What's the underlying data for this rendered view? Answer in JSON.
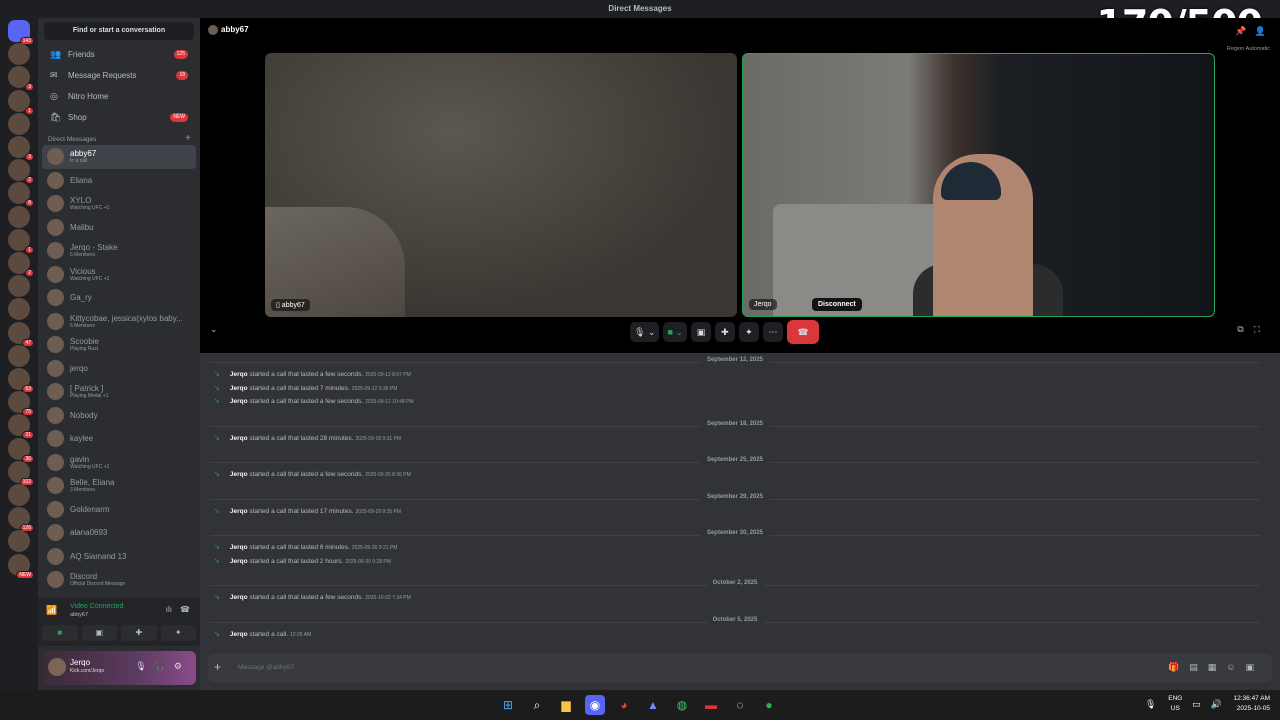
{
  "window": {
    "title": "Direct Messages",
    "counter": "170/500"
  },
  "sidebar": {
    "find": "Find or start a conversation",
    "nav": [
      {
        "label": "Friends",
        "badge": "125",
        "icon": "friends-icon",
        "glyph": "👥"
      },
      {
        "label": "Message Requests",
        "badge": "18",
        "icon": "mail-icon",
        "glyph": "✉"
      },
      {
        "label": "Nitro Home",
        "badge": "",
        "icon": "nitro-icon",
        "glyph": "◎"
      },
      {
        "label": "Shop",
        "badge": "NEW",
        "icon": "shop-icon",
        "glyph": "🛍"
      }
    ],
    "dm_header": "Direct Messages",
    "dms": [
      {
        "name": "abby67",
        "sub": "In a call",
        "active": true
      },
      {
        "name": "Eliana",
        "sub": ""
      },
      {
        "name": "XYLO",
        "sub": "Watching UFC +1"
      },
      {
        "name": "Malibu",
        "sub": ""
      },
      {
        "name": "Jerqo - Stake",
        "sub": "6 Members"
      },
      {
        "name": "Vicious",
        "sub": "Watching UFC +1"
      },
      {
        "name": "Ga_ry",
        "sub": ""
      },
      {
        "name": "Kittycobae, jessica(xylos baby...",
        "sub": "6 Members"
      },
      {
        "name": "Scoobie",
        "sub": "Playing Rust"
      },
      {
        "name": "jerqo",
        "sub": ""
      },
      {
        "name": "[ Patrick ]",
        "sub": "Playing Medal +1"
      },
      {
        "name": "Nobody",
        "sub": ""
      },
      {
        "name": "kaylee",
        "sub": ""
      },
      {
        "name": "gavin",
        "sub": "Watching UFC +1"
      },
      {
        "name": "Belle, Eliana",
        "sub": "3 Members"
      },
      {
        "name": "Goldenarm",
        "sub": ""
      },
      {
        "name": "alana0693",
        "sub": ""
      },
      {
        "name": "AQ Siamand 13",
        "sub": ""
      },
      {
        "name": "Discord",
        "sub": "Official Discord Message"
      }
    ],
    "voice": {
      "status": "Video Connected",
      "channel": "abby67"
    },
    "user": {
      "name": "Jerqo",
      "status": "Kick.com/Jerqo"
    }
  },
  "rail_badges": [
    "143",
    "",
    "3",
    "1",
    "",
    "3",
    "2",
    "8",
    "",
    "1",
    "2",
    "",
    "",
    "47",
    "",
    "63",
    "75",
    "21",
    "36",
    "102",
    "",
    "126",
    "",
    "NEW"
  ],
  "call": {
    "header": "abby67",
    "sub": "Region   Automatic",
    "tile1": "abby67",
    "tile2": "Jerqo",
    "tooltip": "Disconnect"
  },
  "messages": [
    {
      "type": "sep",
      "text": "September 12, 2025"
    },
    {
      "type": "msg",
      "who": "Jerqo",
      "text": "started a call that lasted a few seconds.",
      "ts": "2025-09-12 8:07 PM"
    },
    {
      "type": "msg",
      "who": "Jerqo",
      "text": "started a call that lasted 7 minutes.",
      "ts": "2025-09-12 9:36 PM"
    },
    {
      "type": "msg",
      "who": "Jerqo",
      "text": "started a call that lasted a few seconds.",
      "ts": "2025-09-12 10:48 PM"
    },
    {
      "type": "sep",
      "text": "September 18, 2025"
    },
    {
      "type": "msg",
      "who": "Jerqo",
      "text": "started a call that lasted 28 minutes.",
      "ts": "2025-09-18 9:31 PM"
    },
    {
      "type": "sep",
      "text": "September 25, 2025"
    },
    {
      "type": "msg",
      "who": "Jerqo",
      "text": "started a call that lasted a few seconds.",
      "ts": "2025-09-25 8:36 PM"
    },
    {
      "type": "sep",
      "text": "September 29, 2025"
    },
    {
      "type": "msg",
      "who": "Jerqo",
      "text": "started a call that lasted 17 minutes.",
      "ts": "2025-09-29 9:35 PM"
    },
    {
      "type": "sep",
      "text": "September 30, 2025"
    },
    {
      "type": "msg",
      "who": "Jerqo",
      "text": "started a call that lasted 6 minutes.",
      "ts": "2025-09-30 9:21 PM"
    },
    {
      "type": "msg",
      "who": "Jerqo",
      "text": "started a call that lasted 2 hours.",
      "ts": "2025-09-30 9:28 PM"
    },
    {
      "type": "sep",
      "text": "October 2, 2025"
    },
    {
      "type": "msg",
      "who": "Jerqo",
      "text": "started a call that lasted a few seconds.",
      "ts": "2025-10-02 7:34 PM"
    },
    {
      "type": "sep",
      "text": "October 5, 2025"
    },
    {
      "type": "msg",
      "who": "Jerqo",
      "text": "started a call.",
      "ts": "12:26 AM"
    }
  ],
  "composer": {
    "placeholder": "Message @abby67"
  },
  "taskbar": {
    "lang1": "ENG",
    "lang2": "US",
    "time": "12:36:47 AM",
    "date": "2025-10-05"
  },
  "colors": {
    "accent": "#5865f2",
    "danger": "#da373c",
    "online": "#23a55a"
  }
}
